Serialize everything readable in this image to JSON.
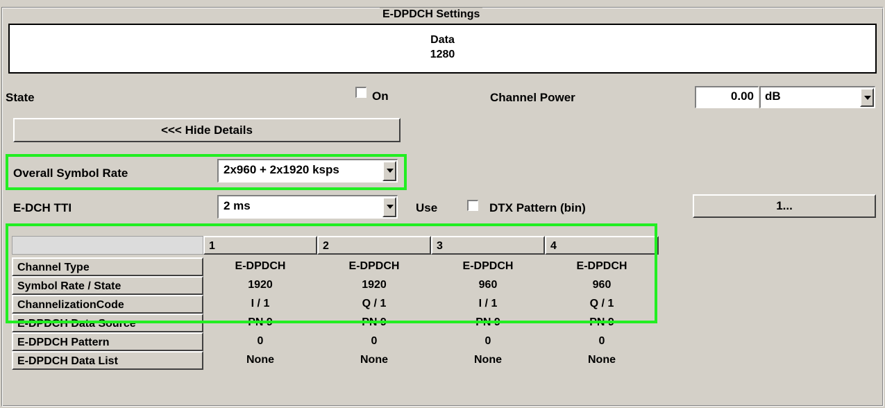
{
  "panel": {
    "title": "E-DPDCH Settings"
  },
  "data_display": {
    "line1": "Data",
    "line2": "1280"
  },
  "state": {
    "label": "State",
    "checkbox_label": "On",
    "checked": false
  },
  "channel_power": {
    "label": "Channel Power",
    "value": "0.00",
    "unit": "dB"
  },
  "details_button": {
    "label": "<<< Hide Details"
  },
  "overall_symbol_rate": {
    "label": "Overall Symbol Rate",
    "value": "2x960 + 2x1920 ksps"
  },
  "edch_tti": {
    "label": "E-DCH TTI",
    "value": "2 ms"
  },
  "dtx": {
    "use_label": "Use",
    "checkbox_label": "DTX Pattern (bin)",
    "checked": false,
    "button_label": "1..."
  },
  "table": {
    "columns": [
      "1",
      "2",
      "3",
      "4"
    ],
    "rows": [
      {
        "label": "Channel Type",
        "values": [
          "E-DPDCH",
          "E-DPDCH",
          "E-DPDCH",
          "E-DPDCH"
        ]
      },
      {
        "label": "Symbol Rate / State",
        "values": [
          "1920",
          "1920",
          "960",
          "960"
        ]
      },
      {
        "label": "ChannelizationCode",
        "values": [
          "I / 1",
          "Q / 1",
          "I / 1",
          "Q / 1"
        ]
      },
      {
        "label": "E-DPDCH Data Source",
        "values": [
          "PN 9",
          "PN 9",
          "PN 9",
          "PN 9"
        ]
      },
      {
        "label": "E-DPDCH Pattern",
        "values": [
          "0",
          "0",
          "0",
          "0"
        ]
      },
      {
        "label": "E-DPDCH Data List",
        "values": [
          "None",
          "None",
          "None",
          "None"
        ]
      }
    ]
  },
  "colors": {
    "background": "#d4d0c8",
    "highlight": "#22ee22"
  }
}
